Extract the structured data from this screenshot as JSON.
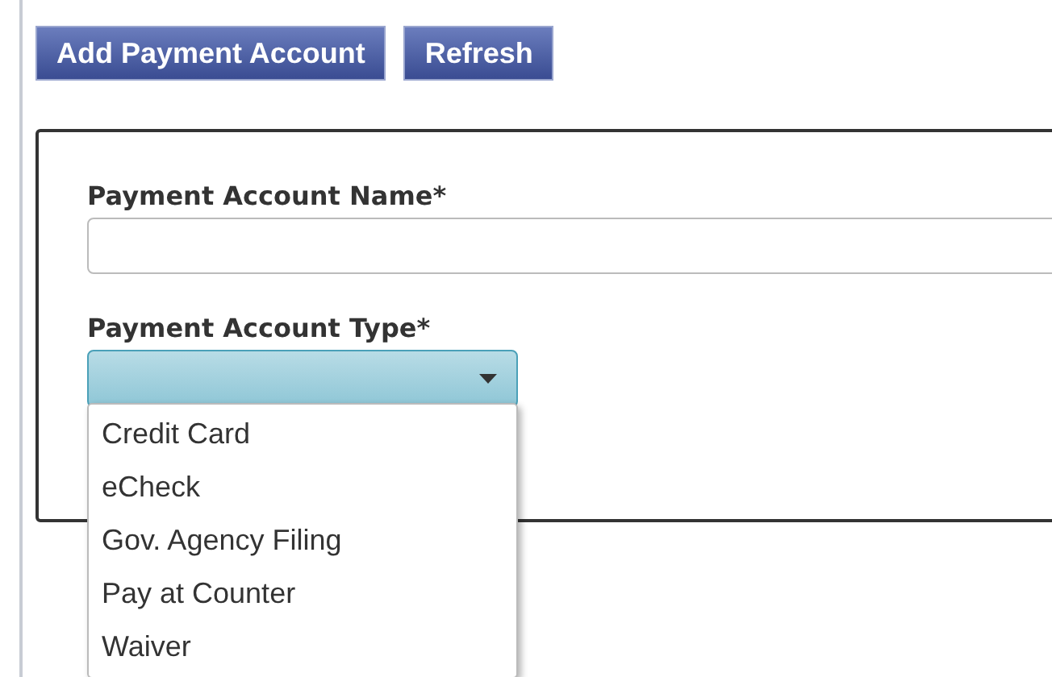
{
  "toolbar": {
    "buttons": [
      "Add Payment Account",
      "Refresh"
    ]
  },
  "form": {
    "name_field": {
      "label": "Payment Account Name*"
    },
    "type_field": {
      "label": "Payment Account Type*",
      "expanded": true,
      "options": [
        {
          "label": "Credit Card"
        },
        {
          "label": "eCheck"
        },
        {
          "label": "Gov. Agency Filing"
        },
        {
          "label": "Pay at Counter"
        },
        {
          "label": "Waiver"
        }
      ]
    }
  }
}
